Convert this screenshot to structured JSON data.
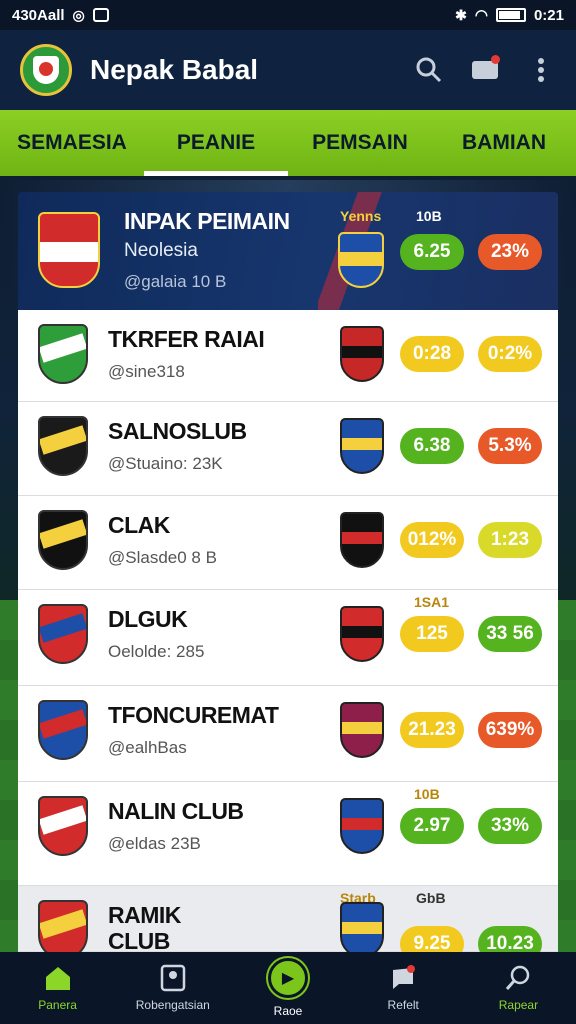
{
  "status_bar": {
    "left_text": "430Aall",
    "time": "0:21"
  },
  "app": {
    "title": "Nepak Babal"
  },
  "tabs": [
    {
      "label": "SEMAESIA",
      "active": false
    },
    {
      "label": "PEANIE",
      "active": true
    },
    {
      "label": "PEMSAIN",
      "active": false
    },
    {
      "label": "BAMIAN",
      "active": false
    }
  ],
  "featured": {
    "name": "INPAK PEIMAIN",
    "subtitle": "Neolesia",
    "handle": "@galaia 10 B",
    "label": "Yenns",
    "label2": "10B",
    "odds": [
      "6.25",
      "23%"
    ]
  },
  "rows": [
    {
      "name": "TKRFER RAIAI",
      "handle": "@sine318",
      "odds": [
        "0:28",
        "0:2%"
      ],
      "colors": [
        "#f2c91e",
        "#f2c91e"
      ],
      "top_label": ""
    },
    {
      "name": "SALNOSLUB",
      "handle": "@Stuaino: 23K",
      "odds": [
        "6.38",
        "5.3%"
      ],
      "colors": [
        "#54b31f",
        "#e8592a"
      ],
      "top_label": ""
    },
    {
      "name": "CLAK",
      "handle": "@Slasde0 8 B",
      "odds": [
        "012%",
        "1:23"
      ],
      "colors": [
        "#f2c91e",
        "#d9d92a"
      ],
      "top_label": ""
    },
    {
      "name": "DLGUK",
      "handle": "Oelolde: 285",
      "odds": [
        "125",
        "33 56"
      ],
      "colors": [
        "#f2c91e",
        "#54b31f"
      ],
      "top_label": "1SA1"
    },
    {
      "name": "TFONCUREMAT",
      "handle": "@ealhBas",
      "odds": [
        "21.23",
        "639%"
      ],
      "colors": [
        "#f2c91e",
        "#e8592a"
      ],
      "top_label": ""
    },
    {
      "name": "NALIN CLUB",
      "handle": "@eldas 23B",
      "odds": [
        "2.97",
        "33%"
      ],
      "colors": [
        "#54b31f",
        "#54b31f"
      ],
      "top_label": "10B"
    },
    {
      "name": "RAMIK CLUB",
      "handle": "",
      "odds": [
        "9.25",
        "10.23"
      ],
      "colors": [
        "#f2c91e",
        "#54b31f"
      ],
      "top_label": "Starb"
    }
  ],
  "last_row_label2": "GbB",
  "nav": [
    {
      "label": "Panera",
      "icon": "home-icon"
    },
    {
      "label": "Robengatsian",
      "icon": "profile-icon"
    },
    {
      "label": "Raoe",
      "icon": "play-icon"
    },
    {
      "label": "Refelt",
      "icon": "notification-icon"
    },
    {
      "label": "Rapear",
      "icon": "search-icon"
    }
  ]
}
